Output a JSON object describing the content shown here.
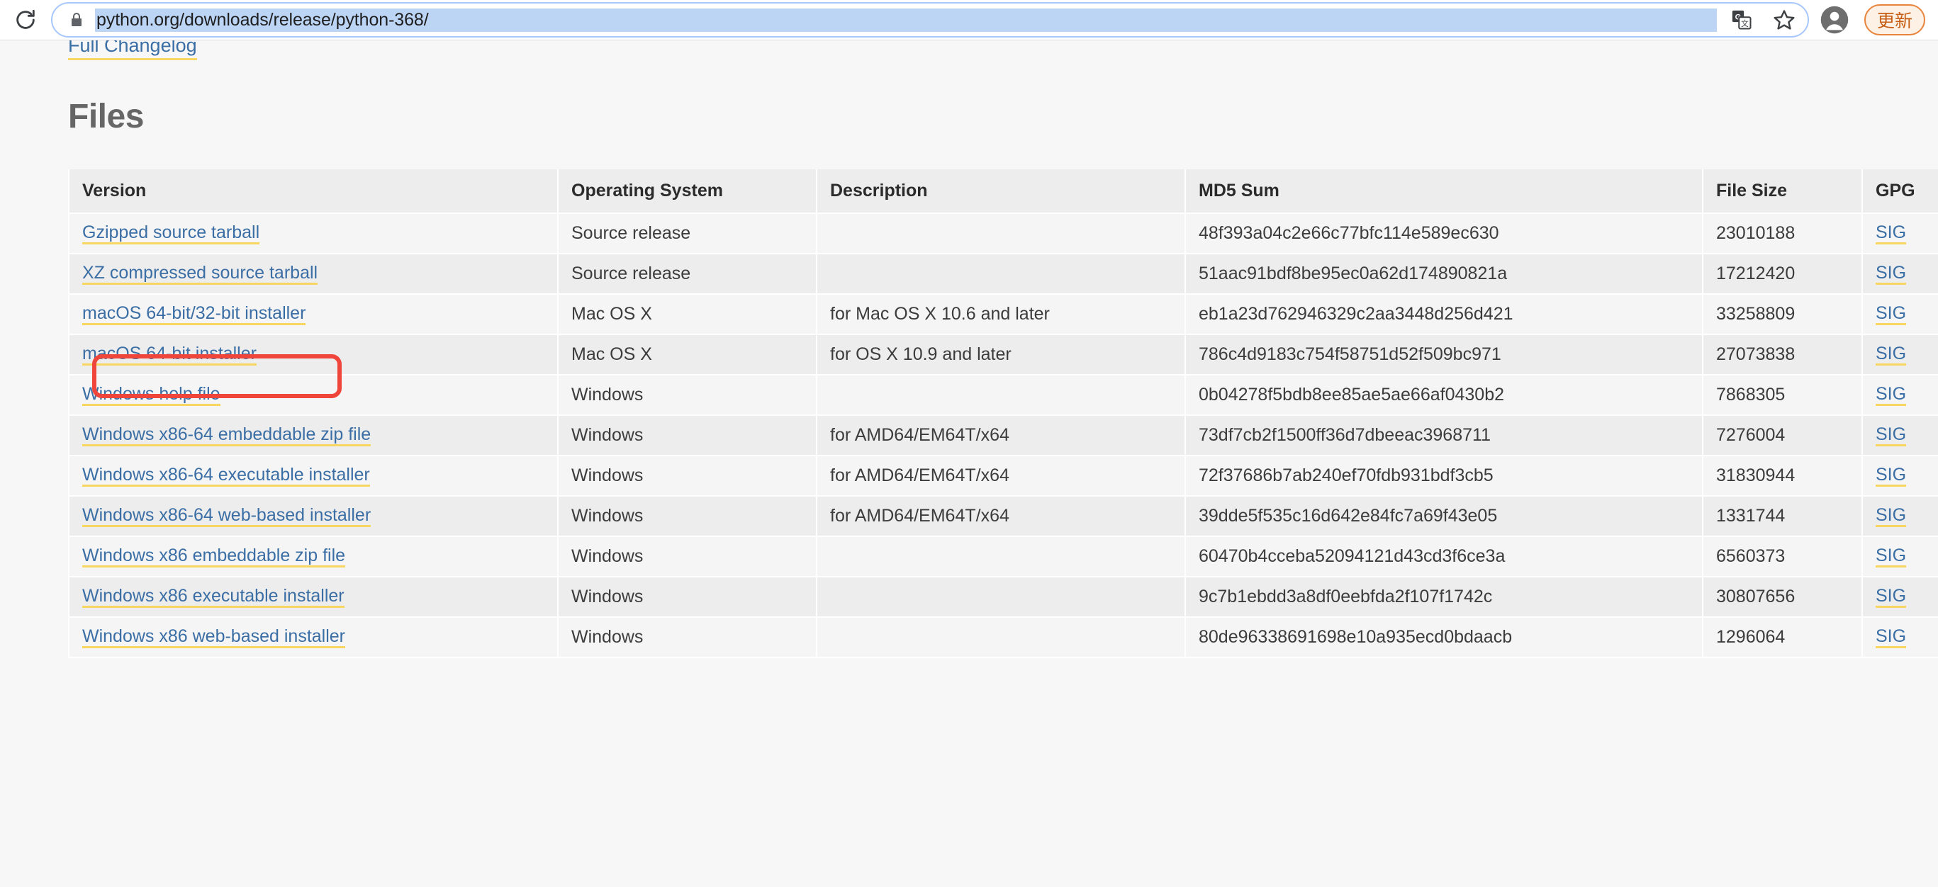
{
  "browser": {
    "reload_icon": "reload-icon",
    "lock_icon": "lock-icon",
    "url": "python.org/downloads/release/python-368/",
    "translate_icon": "translate-icon",
    "bookmark_icon": "bookmark-star-icon",
    "profile_icon": "profile-avatar-icon",
    "update_button_label": "更新",
    "accent_border": "#a8c7fa",
    "update_accent": "#e8833a"
  },
  "page": {
    "changelog_link": "Full Changelog",
    "heading": "Files",
    "link_color": "#3a6ea5",
    "link_underline_color": "#f7d762",
    "annotation_color": "#f0453a"
  },
  "table": {
    "columns": [
      "Version",
      "Operating System",
      "Description",
      "MD5 Sum",
      "File Size",
      "GPG"
    ],
    "gpg_label": "SIG",
    "rows": [
      {
        "version": "Gzipped source tarball",
        "os": "Source release",
        "description": "",
        "md5": "48f393a04c2e66c77bfc114e589ec630",
        "size": "23010188",
        "gpg": "SIG"
      },
      {
        "version": "XZ compressed source tarball",
        "os": "Source release",
        "description": "",
        "md5": "51aac91bdf8be95ec0a62d174890821a",
        "size": "17212420",
        "gpg": "SIG"
      },
      {
        "version": "macOS 64-bit/32-bit installer",
        "os": "Mac OS X",
        "description": "for Mac OS X 10.6 and later",
        "md5": "eb1a23d762946329c2aa3448d256d421",
        "size": "33258809",
        "gpg": "SIG"
      },
      {
        "version": "macOS 64-bit installer",
        "os": "Mac OS X",
        "description": "for OS X 10.9 and later",
        "md5": "786c4d9183c754f58751d52f509bc971",
        "size": "27073838",
        "gpg": "SIG"
      },
      {
        "version": "Windows help file",
        "os": "Windows",
        "description": "",
        "md5": "0b04278f5bdb8ee85ae5ae66af0430b2",
        "size": "7868305",
        "gpg": "SIG"
      },
      {
        "version": "Windows x86-64 embeddable zip file",
        "os": "Windows",
        "description": "for AMD64/EM64T/x64",
        "md5": "73df7cb2f1500ff36d7dbeeac3968711",
        "size": "7276004",
        "gpg": "SIG"
      },
      {
        "version": "Windows x86-64 executable installer",
        "os": "Windows",
        "description": "for AMD64/EM64T/x64",
        "md5": "72f37686b7ab240ef70fdb931bdf3cb5",
        "size": "31830944",
        "gpg": "SIG"
      },
      {
        "version": "Windows x86-64 web-based installer",
        "os": "Windows",
        "description": "for AMD64/EM64T/x64",
        "md5": "39dde5f535c16d642e84fc7a69f43e05",
        "size": "1331744",
        "gpg": "SIG"
      },
      {
        "version": "Windows x86 embeddable zip file",
        "os": "Windows",
        "description": "",
        "md5": "60470b4cceba52094121d43cd3f6ce3a",
        "size": "6560373",
        "gpg": "SIG"
      },
      {
        "version": "Windows x86 executable installer",
        "os": "Windows",
        "description": "",
        "md5": "9c7b1ebdd3a8df0eebfda2f107f1742c",
        "size": "30807656",
        "gpg": "SIG"
      },
      {
        "version": "Windows x86 web-based installer",
        "os": "Windows",
        "description": "",
        "md5": "80de96338691698e10a935ecd0bdaacb",
        "size": "1296064",
        "gpg": "SIG"
      }
    ]
  }
}
